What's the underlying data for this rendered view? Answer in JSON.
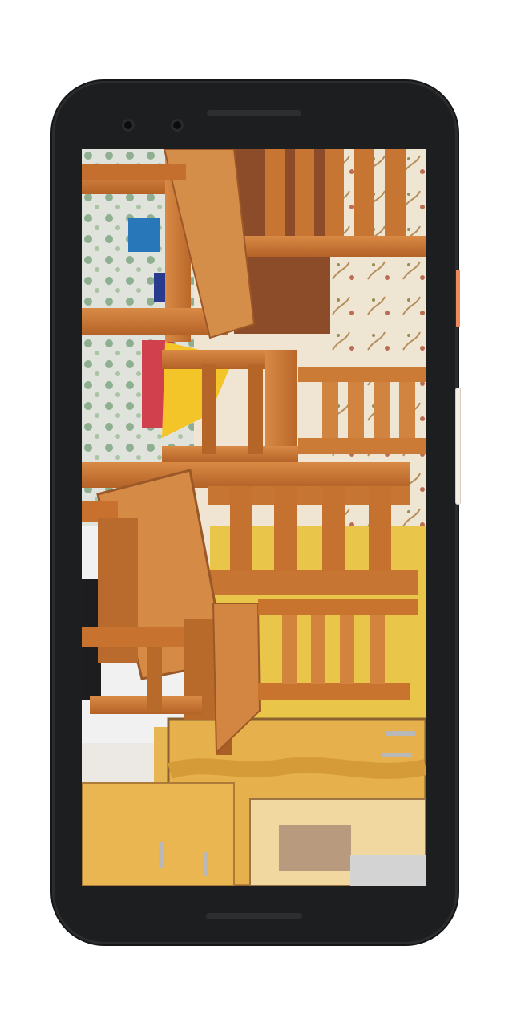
{
  "device": {
    "model_label": "",
    "frame_color": "#1d1e20",
    "power_button_color": "#f08a5b",
    "volume_button_color": "#f4eee8"
  },
  "screen": {
    "content": "camera-ar-view",
    "orientation": "rotated-landscape",
    "icons": {
      "camera_left": "front-camera-icon",
      "camera_right": "sensor-icon"
    }
  },
  "scene": {
    "object": "wooden-chairs-ar-model",
    "wood_color": "#c97a36",
    "wood_dark": "#8f4f1d",
    "wood_light": "#df9a57",
    "floor_color": "#e7c347",
    "wall_color": "#f2e8d6",
    "cabinet_color": "#e5ac45"
  }
}
